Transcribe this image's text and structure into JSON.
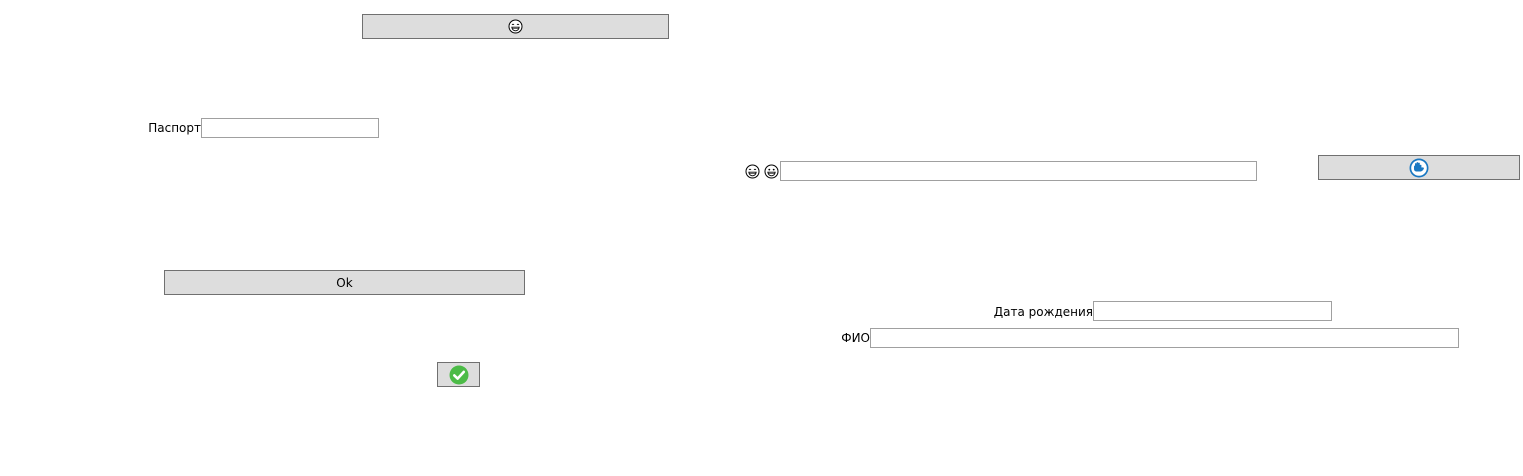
{
  "top_emoji_button": {
    "icon": "grinning-face-emoji-icon"
  },
  "passport": {
    "label": "Паспорт",
    "value": "",
    "placeholder": ""
  },
  "ok_button": {
    "label": "Ok"
  },
  "confirm_button": {
    "icon": "green-checkmark-icon",
    "color": "#4cbb47"
  },
  "emoji_row": {
    "icons": [
      "grinning-face-emoji-icon",
      "grinning-face-emoji-icon"
    ],
    "value": "",
    "placeholder": ""
  },
  "blue_icon_button": {
    "icon": "blue-hand-icon",
    "color": "#1a78c2"
  },
  "birth_date": {
    "label": "Дата рождения",
    "value": "",
    "placeholder": ""
  },
  "full_name": {
    "label": "ФИО",
    "value": "",
    "placeholder": ""
  }
}
